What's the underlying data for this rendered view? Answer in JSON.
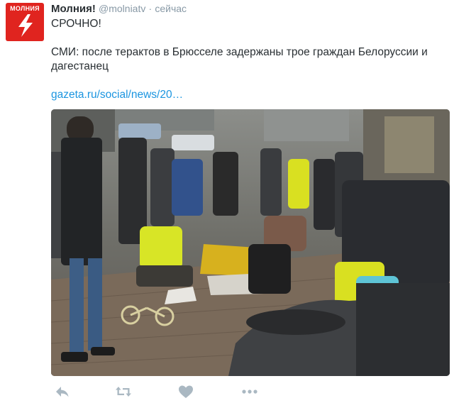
{
  "avatar": {
    "label": "МОЛНИЯ",
    "icon": "lightning-bolt-icon",
    "color": "#e0241f"
  },
  "header": {
    "name": "Молния!",
    "handle": "@molniatv",
    "separator": "·",
    "time": "сейчас"
  },
  "tweet": {
    "line1": "СРОЧНО!",
    "line2": "СМИ: после терактов в Брюсселе задержаны трое граждан Белоруссии и дагестанец",
    "link": "gazeta.ru/social/news/20…"
  },
  "media": {
    "type": "photo"
  },
  "actions": [
    {
      "icon": "reply-icon"
    },
    {
      "icon": "retweet-icon"
    },
    {
      "icon": "like-heart-icon"
    },
    {
      "icon": "more-icon"
    }
  ],
  "colors": {
    "link": "#1b95e0",
    "muted": "#8899a6",
    "icon": "#aab8c2"
  }
}
